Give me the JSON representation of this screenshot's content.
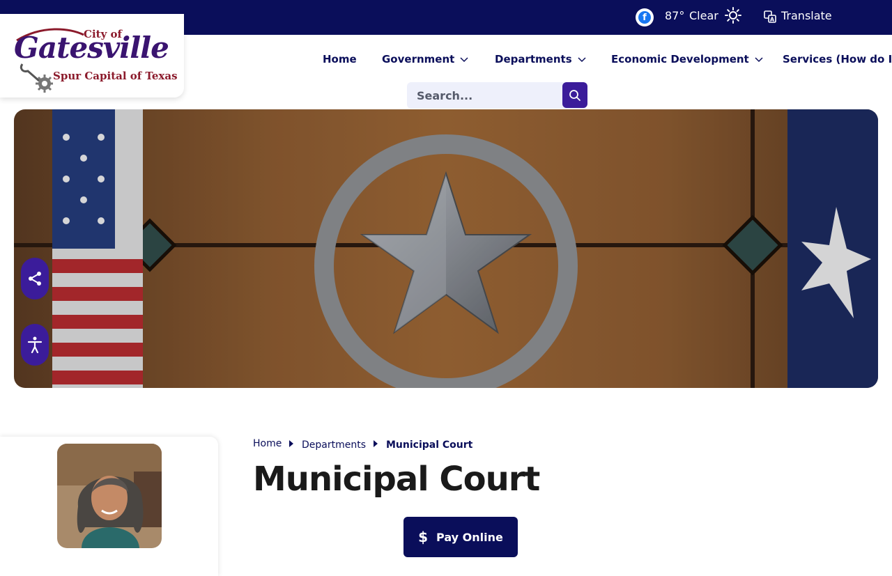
{
  "topbar": {
    "facebook_icon": "facebook-icon",
    "temperature": "87°",
    "condition": "Clear",
    "weather_icon": "sun-icon",
    "translate_label": "Translate"
  },
  "logo": {
    "city_of": "City of",
    "name": "Gatesville",
    "tagline": "Spur Capital of Texas"
  },
  "nav": {
    "home": "Home",
    "government": "Government",
    "departments": "Departments",
    "economic_development": "Economic Development",
    "services": "Services (How do I?)"
  },
  "search": {
    "placeholder": "Search..."
  },
  "breadcrumb": {
    "home": "Home",
    "departments": "Departments",
    "current": "Municipal Court"
  },
  "page": {
    "title": "Municipal Court",
    "pay_online": "Pay Online"
  },
  "colors": {
    "navy": "#0a0e5a",
    "purple": "#3b1c9a",
    "logo_red": "#8b1a2b",
    "logo_purple": "#3a1470"
  }
}
